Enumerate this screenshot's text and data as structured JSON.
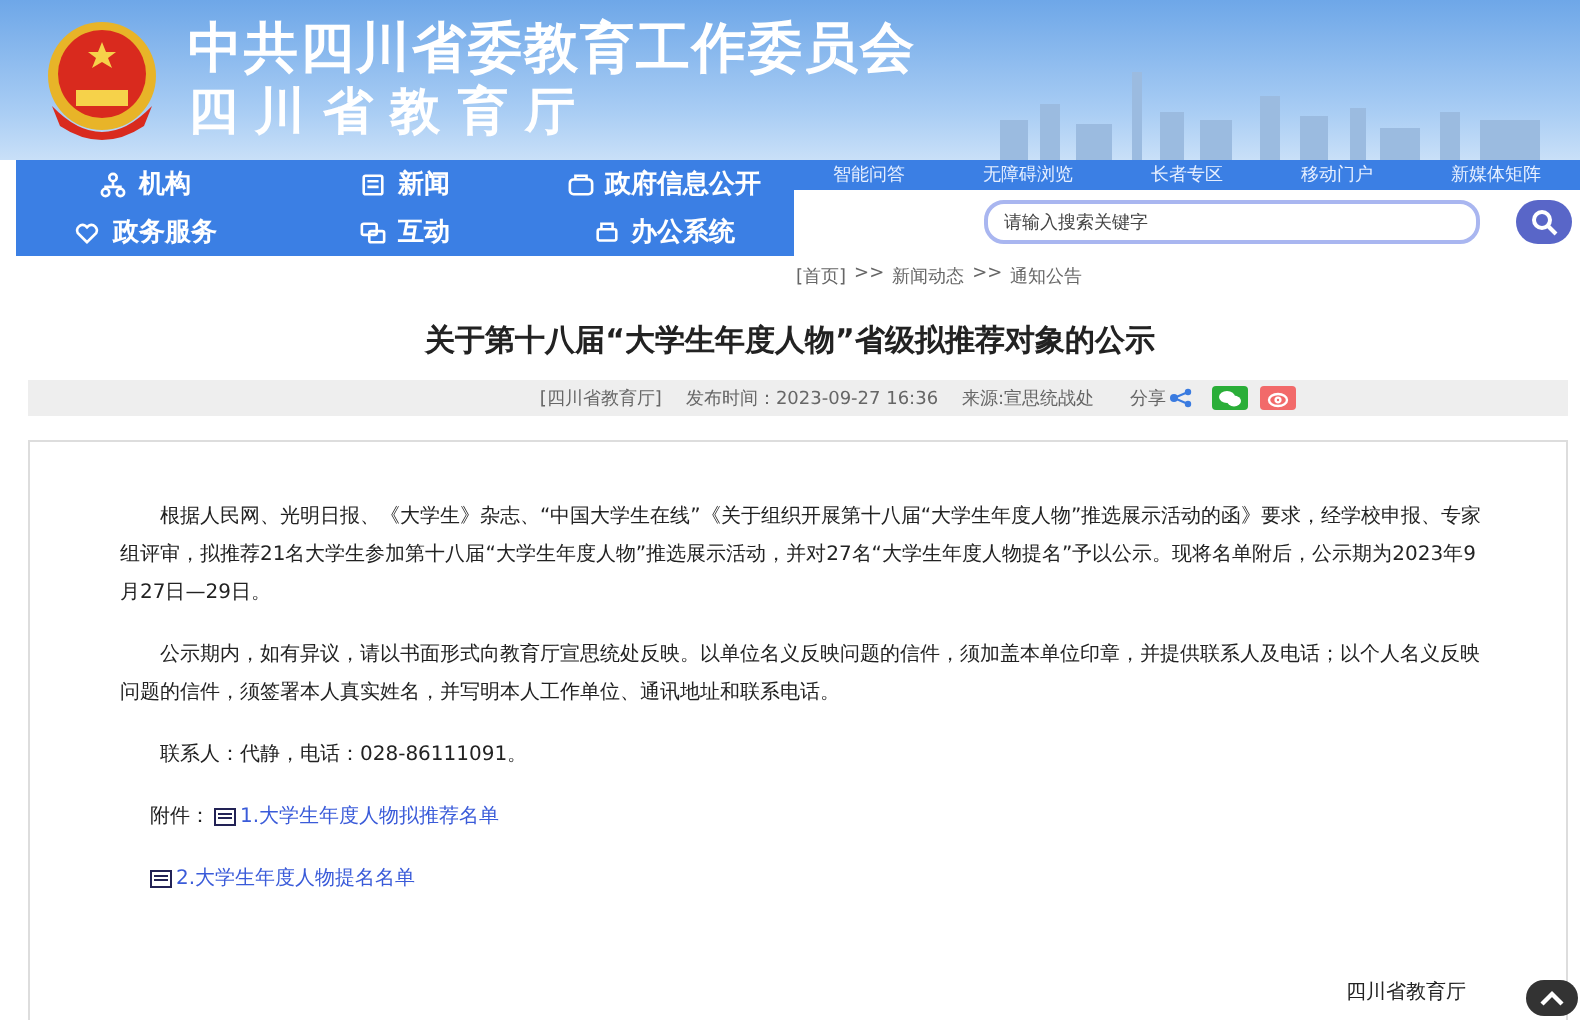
{
  "header": {
    "title": "中共四川省委教育工作委员会",
    "subtitle": "四 川 省 教 育 厅"
  },
  "nav": [
    {
      "label": "机构",
      "kind": "org"
    },
    {
      "label": "新闻",
      "kind": "news"
    },
    {
      "label": "政府信息公开",
      "kind": "info"
    },
    {
      "label": "政务服务",
      "kind": "service"
    },
    {
      "label": "互动",
      "kind": "chat"
    },
    {
      "label": "办公系统",
      "kind": "office"
    }
  ],
  "top_links": [
    "智能问答",
    "无障碍浏览",
    "长者专区",
    "移动门户",
    "新媒体矩阵"
  ],
  "search": {
    "placeholder": "请输入搜索关键字"
  },
  "breadcrumb": [
    "[首页]",
    ">>",
    "新闻动态",
    ">>",
    "通知公告"
  ],
  "article": {
    "title": "关于第十八届“大学生年度人物”省级拟推荐对象的公示",
    "meta": [
      "[四川省教育厅]",
      "发布时间：2023-09-27 16:36",
      "来源:宣思统战处"
    ],
    "share_label": "分享",
    "paragraphs": [
      "根据人民网、光明日报、《大学生》杂志、“中国大学生在线”《关于组织开展第十八届“大学生年度人物”推选展示活动的函》要求，经学校申报、专家组评审，拟推荐21名大学生参加第十八届“大学生年度人物”推选展示活动，并对27名“大学生年度人物提名”予以公示。现将名单附后，公示期为2023年9月27日—29日。",
      "公示期内，如有异议，请以书面形式向教育厅宣思统处反映。以单位名义反映问题的信件，须加盖本单位印章，并提供联系人及电话；以个人名义反映问题的信件，须签署本人真实姓名，并写明本人工作单位、通讯地址和联系电话。",
      "联系人：代静，电话：028-86111091。"
    ],
    "attachment_label": "附件：",
    "attachments": [
      "1.大学生年度人物拟推荐名单",
      "2.大学生年度人物提名名单"
    ],
    "signature": "四川省教育厅"
  }
}
